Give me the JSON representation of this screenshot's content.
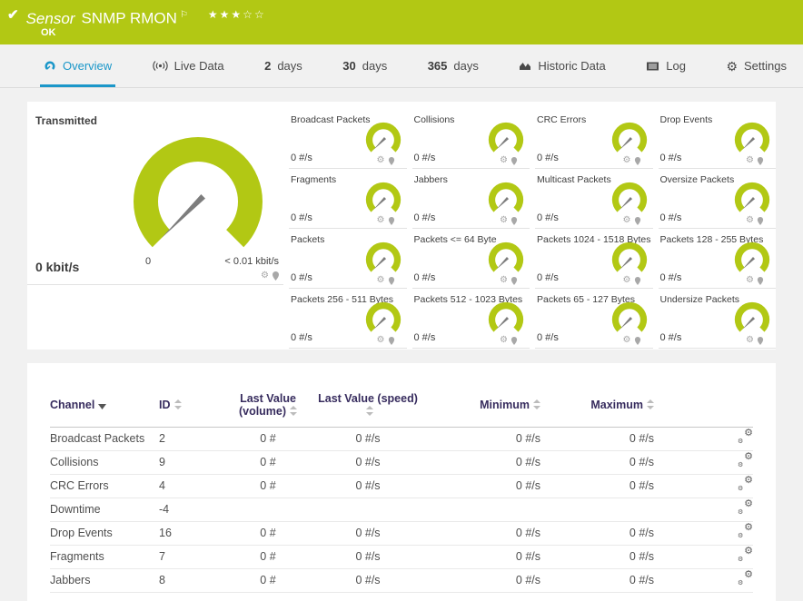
{
  "header": {
    "title_prefix": "Sensor",
    "title": "SNMP RMON",
    "status": "OK",
    "rating": {
      "filled": 3,
      "empty": 2
    },
    "colors": {
      "bar": "#b2c814",
      "gauge": "#b2c814",
      "active_tab": "#1b97c9"
    }
  },
  "tabs": [
    {
      "icon": "gauge-icon",
      "label": "Overview",
      "active": true
    },
    {
      "icon": "live-icon",
      "label": "Live Data"
    },
    {
      "num": "2",
      "label": "days"
    },
    {
      "num": "30",
      "label": "days"
    },
    {
      "num": "365",
      "label": "days"
    },
    {
      "icon": "historic-icon",
      "label": "Historic Data"
    },
    {
      "icon": "log-icon",
      "label": "Log"
    },
    {
      "icon": "settings-icon",
      "label": "Settings"
    }
  ],
  "gauges_panel": {
    "main": {
      "title": "Transmitted",
      "value": "0 kbit/s",
      "scale_min": "0",
      "scale_max": "< 0.01 kbit/s"
    },
    "small": [
      {
        "title": "Broadcast Packets",
        "value": "0 #/s"
      },
      {
        "title": "Collisions",
        "value": "0 #/s"
      },
      {
        "title": "CRC Errors",
        "value": "0 #/s"
      },
      {
        "title": "Drop Events",
        "value": "0 #/s"
      },
      {
        "title": "Fragments",
        "value": "0 #/s"
      },
      {
        "title": "Jabbers",
        "value": "0 #/s"
      },
      {
        "title": "Multicast Packets",
        "value": "0 #/s"
      },
      {
        "title": "Oversize Packets",
        "value": "0 #/s"
      },
      {
        "title": "Packets",
        "value": "0 #/s"
      },
      {
        "title": "Packets <= 64 Byte",
        "value": "0 #/s"
      },
      {
        "title": "Packets 1024 - 1518 Bytes",
        "value": "0 #/s"
      },
      {
        "title": "Packets 128 - 255 Bytes",
        "value": "0 #/s"
      },
      {
        "title": "Packets 256 - 511 Bytes",
        "value": "0 #/s"
      },
      {
        "title": "Packets 512 - 1023 Bytes",
        "value": "0 #/s"
      },
      {
        "title": "Packets 65 - 127 Bytes",
        "value": "0 #/s"
      },
      {
        "title": "Undersize Packets",
        "value": "0 #/s"
      }
    ]
  },
  "table": {
    "columns": [
      {
        "label": "Channel",
        "sort": "desc",
        "align": "al"
      },
      {
        "label": "ID",
        "sort": "both",
        "align": "al"
      },
      {
        "label": "Last Value (volume)",
        "sort": "both",
        "align": "ac"
      },
      {
        "label": "Last Value (speed)",
        "sort": "both",
        "align": "ac"
      },
      {
        "label": "Minimum",
        "sort": "both",
        "align": "ar"
      },
      {
        "label": "Maximum",
        "sort": "both",
        "align": "ar"
      },
      {
        "label": "",
        "sort": "none",
        "align": "ar"
      }
    ],
    "rows": [
      {
        "channel": "Broadcast Packets",
        "id": "2",
        "last_volume": "0 #",
        "last_speed": "0 #/s",
        "minimum": "0 #/s",
        "maximum": "0 #/s"
      },
      {
        "channel": "Collisions",
        "id": "9",
        "last_volume": "0 #",
        "last_speed": "0 #/s",
        "minimum": "0 #/s",
        "maximum": "0 #/s"
      },
      {
        "channel": "CRC Errors",
        "id": "4",
        "last_volume": "0 #",
        "last_speed": "0 #/s",
        "minimum": "0 #/s",
        "maximum": "0 #/s"
      },
      {
        "channel": "Downtime",
        "id": "-4",
        "last_volume": "",
        "last_speed": "",
        "minimum": "",
        "maximum": ""
      },
      {
        "channel": "Drop Events",
        "id": "16",
        "last_volume": "0 #",
        "last_speed": "0 #/s",
        "minimum": "0 #/s",
        "maximum": "0 #/s"
      },
      {
        "channel": "Fragments",
        "id": "7",
        "last_volume": "0 #",
        "last_speed": "0 #/s",
        "minimum": "0 #/s",
        "maximum": "0 #/s"
      },
      {
        "channel": "Jabbers",
        "id": "8",
        "last_volume": "0 #",
        "last_speed": "0 #/s",
        "minimum": "0 #/s",
        "maximum": "0 #/s"
      }
    ]
  }
}
